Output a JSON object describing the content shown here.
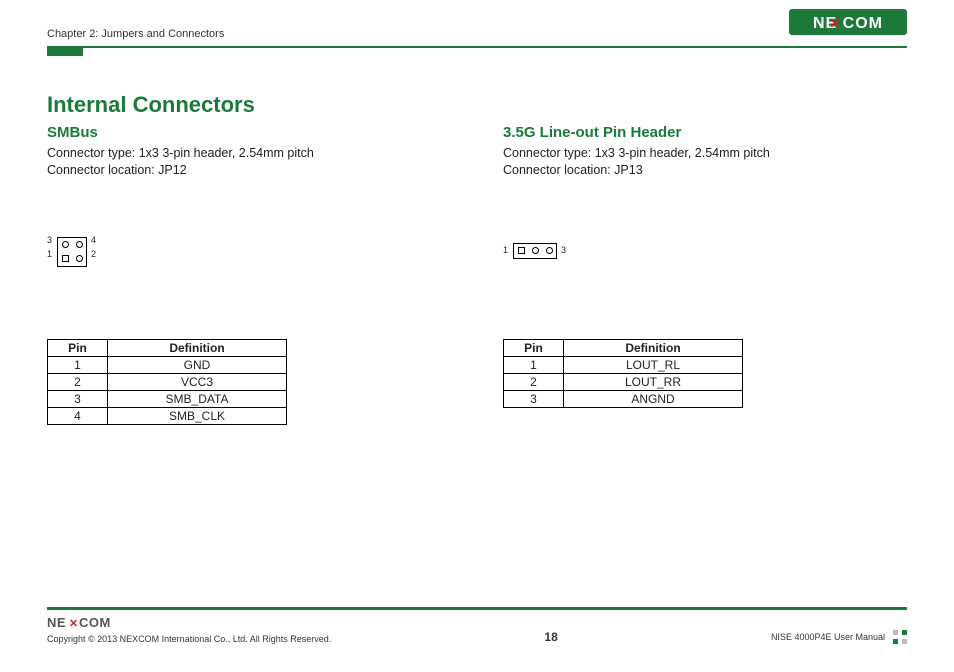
{
  "header": {
    "chapter": "Chapter 2: Jumpers and Connectors",
    "logo_text": "NEXCOM"
  },
  "main": {
    "title": "Internal Connectors",
    "left": {
      "subtitle": "SMBus",
      "spec_line1": "Connector type: 1x3 3-pin header, 2.54mm pitch",
      "spec_line2": "Connector location: JP12",
      "diagram_labels": {
        "tl": "3",
        "tr": "4",
        "bl": "1",
        "br": "2"
      },
      "table": {
        "headers": {
          "pin": "Pin",
          "def": "Definition"
        },
        "rows": [
          {
            "pin": "1",
            "def": "GND"
          },
          {
            "pin": "2",
            "def": "VCC3"
          },
          {
            "pin": "3",
            "def": "SMB_DATA"
          },
          {
            "pin": "4",
            "def": "SMB_CLK"
          }
        ]
      }
    },
    "right": {
      "subtitle": "3.5G Line-out Pin Header",
      "spec_line1": "Connector type: 1x3 3-pin header, 2.54mm pitch",
      "spec_line2": "Connector location: JP13",
      "diagram_labels": {
        "left": "1",
        "right": "3"
      },
      "table": {
        "headers": {
          "pin": "Pin",
          "def": "Definition"
        },
        "rows": [
          {
            "pin": "1",
            "def": "LOUT_RL"
          },
          {
            "pin": "2",
            "def": "LOUT_RR"
          },
          {
            "pin": "3",
            "def": "ANGND"
          }
        ]
      }
    }
  },
  "footer": {
    "logo_text": "NEXCOM",
    "copyright": "Copyright © 2013 NEXCOM International Co., Ltd. All Rights Reserved.",
    "page_number": "18",
    "manual": "NISE 4000P4E User Manual"
  }
}
